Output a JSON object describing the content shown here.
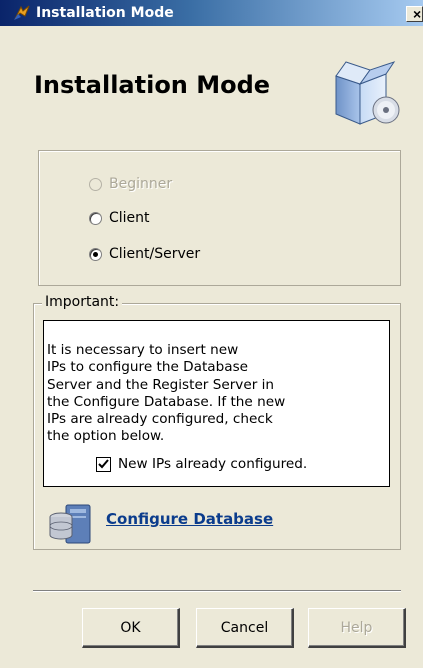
{
  "window": {
    "title": "Installation Mode",
    "close_glyph": "×"
  },
  "header": {
    "title": "Installation Mode",
    "icon": "software-box-cd-icon"
  },
  "mode_group": {
    "options": [
      {
        "label": "Beginner",
        "selected": false,
        "enabled": false
      },
      {
        "label": "Client",
        "selected": false,
        "enabled": true
      },
      {
        "label": "Client/Server",
        "selected": true,
        "enabled": true
      }
    ]
  },
  "important_group": {
    "legend": "Important:",
    "message": "       It is necessary to insert new\nIPs to configure the Database\nServer and the Register Server in\nthe Configure Database. If the new\nIPs are already configured, check\nthe option below.",
    "checkbox": {
      "label": "New IPs already configured.",
      "checked": true
    },
    "link": {
      "label": "Configure Database",
      "icon": "database-server-icon"
    }
  },
  "buttons": {
    "ok": "OK",
    "cancel": "Cancel",
    "help": "Help"
  },
  "colors": {
    "dialog_bg": "#ece9d8",
    "title_bar": "#0a246a",
    "link": "#0b3c8c"
  }
}
